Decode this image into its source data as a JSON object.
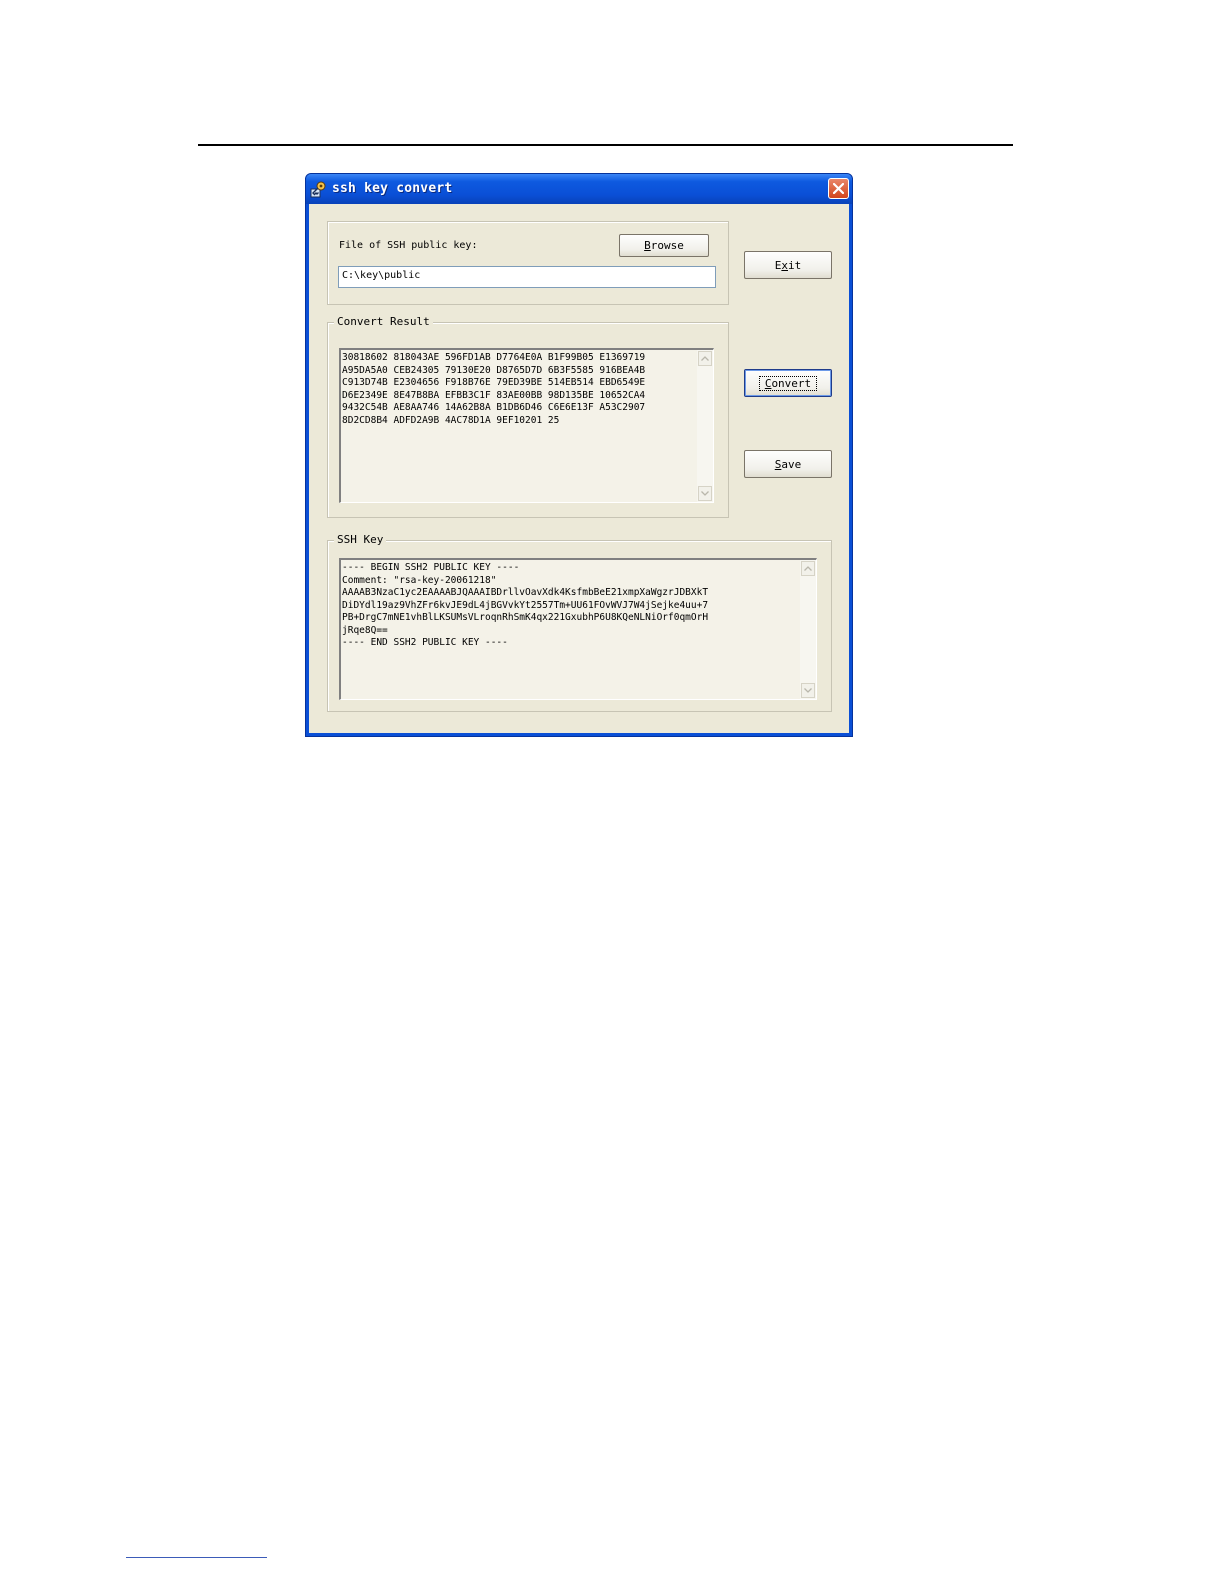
{
  "window": {
    "title": "ssh key convert",
    "icon": "key-app-icon",
    "close_icon": "close-icon"
  },
  "file_group": {
    "label": "File of SSH public key:",
    "browse_label": "Browse",
    "browse_mnemonic": "B",
    "file_path": "C:\\key\\public"
  },
  "convert_group": {
    "label": "Convert Result",
    "result_text": "30818602 818043AE 596FD1AB D7764E0A B1F99B05 E1369719\nA95DA5A0 CEB24305 79130E20 D8765D7D 6B3F5585 916BEA4B\nC913D74B E2304656 F918B76E 79ED39BE 514EB514 EBD6549E\nD6E2349E 8E47B8BA EFBB3C1F 83AE00BB 98D135BE 10652CA4\n9432C54B AE8AA746 14A62B8A B1DB6D46 C6E6E13F A53C2907\n8D2CD8B4 ADFD2A9B 4AC78D1A 9EF10201 25"
  },
  "ssh_group": {
    "label": "SSH Key",
    "key_text": "---- BEGIN SSH2 PUBLIC KEY ----\nComment: \"rsa-key-20061218\"\nAAAAB3NzaC1yc2EAAAABJQAAAIBDrllvOavXdk4KsfmbBeE21xmpXaWgzrJDBXkT\nDiDYdl19az9VhZFr6kvJE9dL4jBGVvkYt2557Tm+UU61FOvWVJ7W4jSejke4uu+7\nPB+DrgC7mNE1vhBlLKSUMsVLroqnRhSmK4qx221GxubhP6U8KQeNLNiOrf0qmOrH\njRqe8Q==\n---- END SSH2 PUBLIC KEY ----"
  },
  "buttons": {
    "exit_label": "Exit",
    "exit_mnemonic": "x",
    "convert_label": "Convert",
    "convert_mnemonic": "C",
    "save_label": "Save",
    "save_mnemonic": "S"
  },
  "colors": {
    "titlebar": "#0a4fd6",
    "dialog_face": "#ece9d8",
    "close_button": "#d2451c"
  }
}
